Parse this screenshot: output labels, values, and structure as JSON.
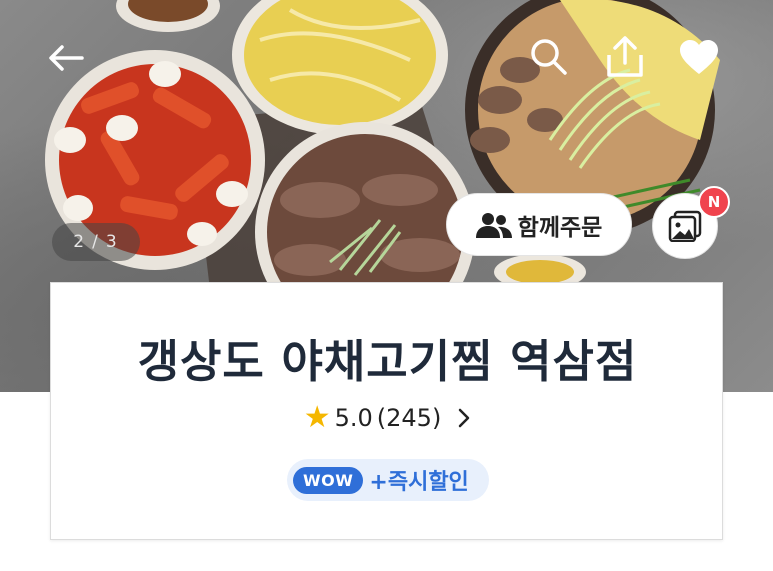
{
  "header": {
    "back_icon": "arrow-left-icon",
    "search_icon": "search-icon",
    "share_icon": "share-icon",
    "favorite_icon": "heart-icon"
  },
  "gallery": {
    "current": "2",
    "total": "3",
    "separator": "/"
  },
  "actions": {
    "group_order_label": "함께주문",
    "group_order_icon": "people-icon",
    "photo_icon": "photo-review-icon",
    "new_badge": "N"
  },
  "store": {
    "name": "갱상도 야채고기찜 역삼점",
    "rating": "5.0",
    "review_count": "(245)",
    "wow_badge": "WOW",
    "wow_text": "+즉시할인"
  },
  "colors": {
    "accent_blue": "#2f6fd8",
    "badge_red": "#f0434d",
    "star_yellow": "#f5b700"
  }
}
